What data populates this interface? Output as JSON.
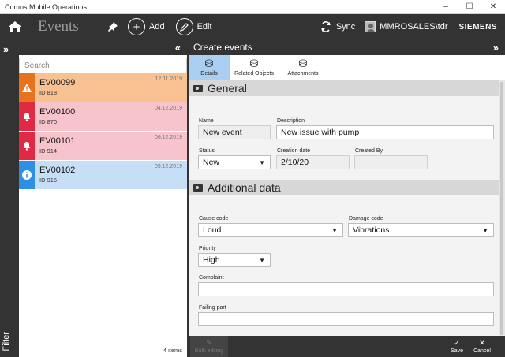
{
  "window": {
    "title": "Comos Mobile Operations",
    "minimize": "–",
    "maximize": "☐",
    "close": "✕"
  },
  "appbar": {
    "title": "Events",
    "add_label": "Add",
    "edit_label": "Edit",
    "sync_label": "Sync",
    "user": "MMROSALES\\tdr",
    "brand": "SIEMENS"
  },
  "sidebar": {
    "filter_label": "Filter"
  },
  "list": {
    "search_placeholder": "Search",
    "items": [
      {
        "id": "EV00099",
        "sub": "ID 818",
        "date": "12.11.2019",
        "icon": "warning-icon",
        "color": "#f7c191",
        "iconbg": "#e8731f"
      },
      {
        "id": "EV00100",
        "sub": "ID 870",
        "date": "04.12.2019",
        "icon": "bell-icon",
        "color": "#f7c4cc",
        "iconbg": "#e02a45"
      },
      {
        "id": "EV00101",
        "sub": "ID 914",
        "date": "06.12.2019",
        "icon": "bell-icon",
        "color": "#f7c4cc",
        "iconbg": "#e02a45"
      },
      {
        "id": "EV00102",
        "sub": "ID 915",
        "date": "09.12.2019",
        "icon": "info-icon",
        "color": "#c6dff6",
        "iconbg": "#2d8fe6"
      }
    ],
    "count": "4 items"
  },
  "detail": {
    "title": "Create events",
    "tabs": [
      {
        "label": "Details"
      },
      {
        "label": "Related Objects"
      },
      {
        "label": "Attachments"
      }
    ],
    "general": {
      "heading": "General",
      "name_label": "Name",
      "name_value": "New event",
      "description_label": "Description",
      "description_value": "New issue with pump",
      "status_label": "Status",
      "status_value": "New",
      "creation_label": "Creation date",
      "creation_value": "2/10/20",
      "createdby_label": "Created By",
      "createdby_value": ""
    },
    "additional": {
      "heading": "Additional data",
      "cause_label": "Cause code",
      "cause_value": "Loud",
      "damage_label": "Damage code",
      "damage_value": "Vibrations",
      "priority_label": "Priority",
      "priority_value": "High",
      "complaint_label": "Complaint",
      "complaint_value": "",
      "failing_label": "Failing part",
      "failing_value": ""
    }
  },
  "bottombar": {
    "bulk_label": "Bulk editing",
    "save_label": "Save",
    "cancel_label": "Cancel"
  }
}
